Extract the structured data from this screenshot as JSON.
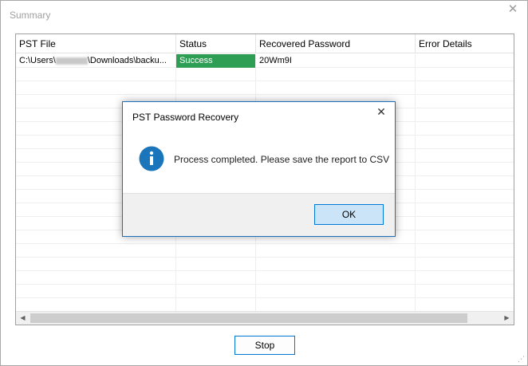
{
  "window": {
    "title": "Summary",
    "close_glyph": "✕"
  },
  "table": {
    "columns": [
      "PST File",
      "Status",
      "Recovered Password",
      "Error Details"
    ],
    "rows": [
      {
        "file_prefix": "C:\\Users\\",
        "file_suffix": "\\Downloads\\backu...",
        "status": "Success",
        "password": "20Wm9I",
        "error": ""
      }
    ],
    "status_color": "#2e9e54"
  },
  "scrollbar": {
    "left_arrow": "◀",
    "right_arrow": "▶"
  },
  "buttons": {
    "stop": "Stop"
  },
  "dialog": {
    "title": "PST Password Recovery",
    "close_glyph": "✕",
    "message": "Process completed. Please save the report to CSV",
    "icon": "info-icon",
    "ok": "OK"
  },
  "resize_grip": "⋰"
}
